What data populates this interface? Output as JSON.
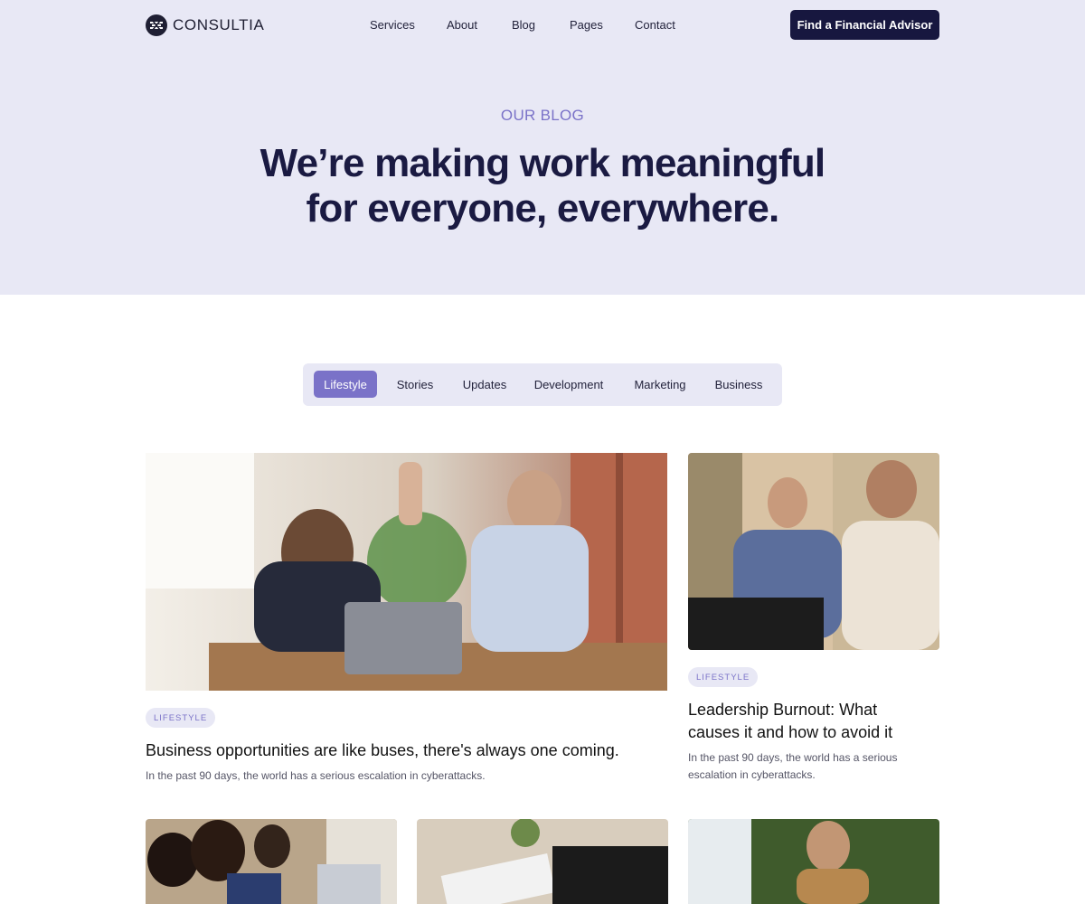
{
  "brand": {
    "name": "CONSULTIA",
    "logo_icon": "consultia-logo-icon"
  },
  "nav": {
    "links": [
      "Services",
      "About",
      "Blog",
      "Pages",
      "Contact"
    ],
    "cta_label": "Find a Financial Advisor"
  },
  "hero": {
    "eyebrow": "OUR BLOG",
    "headline_line1": "We’re making work meaningful",
    "headline_line2": "for everyone, everywhere."
  },
  "tabs": {
    "items": [
      "Lifestyle",
      "Stories",
      "Updates",
      "Development",
      "Marketing",
      "Business"
    ],
    "active": "Lifestyle"
  },
  "posts": [
    {
      "category": "LIFESTYLE",
      "title": "Business opportunities are like buses, there's always one coming.",
      "excerpt": "In the past 90 days, the world has a serious escalation in cyberattacks.",
      "image": "office-high-five-photo"
    },
    {
      "category": "LIFESTYLE",
      "title_line1": "Leadership Burnout: What",
      "title_line2": "causes it and how to avoid it",
      "excerpt_line1": "In the past 90 days, the world has a serious",
      "excerpt_line2": "escalation in cyberattacks.",
      "image": "two-men-meeting-photo"
    }
  ],
  "more_posts_images": [
    "team-working-photo",
    "documents-desk-photo",
    "man-laptop-plants-photo"
  ],
  "colors": {
    "hero_bg": "#e8e8f5",
    "accent": "#7a72c8",
    "navy": "#17173f",
    "text_dark": "#1a1a42"
  }
}
